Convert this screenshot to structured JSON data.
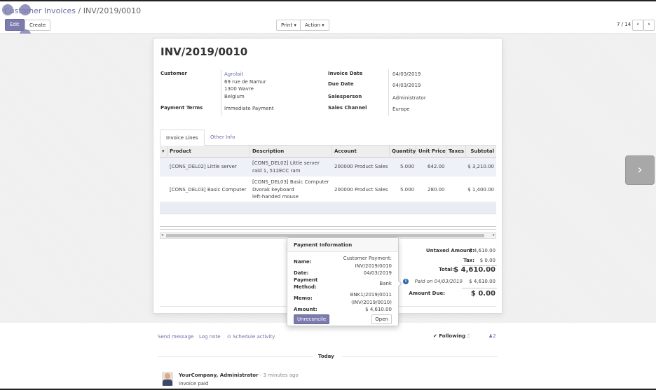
{
  "breadcrumb": {
    "parent": "Customer Invoices",
    "separator": "/",
    "current": "INV/2019/0010"
  },
  "toolbar": {
    "edit": "Edit",
    "create": "Create",
    "print": "Print ▾",
    "action": "Action ▾"
  },
  "pager": {
    "value": "7 / 14",
    "prev": "‹",
    "next": "›"
  },
  "invoice": {
    "title": "INV/2019/0010",
    "customer_label": "Customer",
    "customer_name": "Agrolait",
    "customer_addr1": "69 rue de Namur",
    "customer_addr2": "1300 Wavre",
    "customer_addr3": "Belgium",
    "payment_terms_label": "Payment Terms",
    "payment_terms": "Immediate Payment",
    "invoice_date_label": "Invoice Date",
    "invoice_date": "04/03/2019",
    "due_date_label": "Due Date",
    "due_date": "04/03/2019",
    "salesperson_label": "Salesperson",
    "salesperson": "Administrator",
    "sales_channel_label": "Sales Channel",
    "sales_channel": "Europe"
  },
  "tabs": [
    "Invoice Lines",
    "Other Info"
  ],
  "lines": {
    "sort_icon": "▾",
    "headers": [
      "Product",
      "Description",
      "Account",
      "Quantity",
      "Unit Price",
      "Taxes",
      "Subtotal"
    ],
    "rows": [
      {
        "product": "[CONS_DEL02] Little server",
        "desc1": "[CONS_DEL02] Little server",
        "desc2": "raid 1, 512ECC ram",
        "desc3": "",
        "account": "200000 Product Sales",
        "qty": "5.000",
        "price": "642.00",
        "taxes": "",
        "subtotal": "$ 3,210.00"
      },
      {
        "product": "[CONS_DEL03] Basic Computer",
        "desc1": "[CONS_DEL03] Basic Computer",
        "desc2": "Dvorak keyboard",
        "desc3": "left-handed mouse",
        "account": "200000 Product Sales",
        "qty": "5.000",
        "price": "280.00",
        "taxes": "",
        "subtotal": "$ 1,400.00"
      }
    ]
  },
  "totals": {
    "untaxed_label": "Untaxed Amount:",
    "untaxed": "$ 4,610.00",
    "tax_label": "Tax:",
    "tax": "$ 0.00",
    "total_label": "Total:",
    "total": "$ 4,610.00",
    "paid_on": "Paid on 04/03/2019",
    "paid_amount": "$ 4,610.00",
    "due_label": "Amount Due:",
    "due": "$ 0.00"
  },
  "popover": {
    "title": "Payment Information",
    "name_label": "Name:",
    "name1": "Customer Payment:",
    "name2": "INV/2019/0010",
    "date_label": "Date:",
    "date": "04/03/2019",
    "method_label1": "Payment",
    "method_label2": "Method:",
    "method": "Bank",
    "memo_label": "Memo:",
    "memo1": "BNK1/2019/0011",
    "memo2": "(INV/2019/0010)",
    "amount_label": "Amount:",
    "amount": "$ 4,610.00",
    "unreconcile": "Unreconcile",
    "open": "Open"
  },
  "chatter": {
    "send_message": "Send message",
    "log_note": "Log note",
    "schedule": "⊙ Schedule activity",
    "following": "✔ Following",
    "bell": "♫",
    "followers": "2",
    "today": "Today",
    "author": "YourCompany, Administrator",
    "time": "- 3 minutes ago",
    "message": "Invoice paid"
  }
}
